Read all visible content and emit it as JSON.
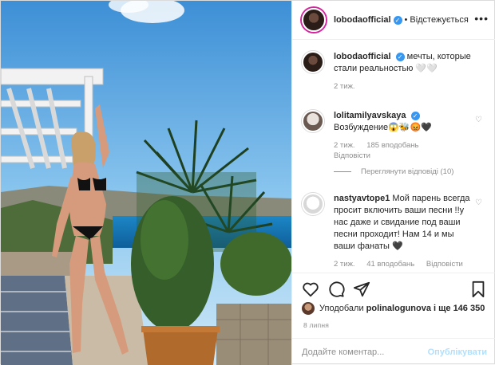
{
  "header": {
    "username": "lobodaofficial",
    "follow_state": "Відстежується",
    "separator": "•",
    "more": "•••"
  },
  "caption": {
    "username": "lobodaofficial",
    "text": "мечты, которые стали реальностью 🤍🤍",
    "time": "2 тиж."
  },
  "comments": [
    {
      "username": "lolitamilyavskaya",
      "text": "Возбуждение😱🐝😡🖤",
      "time": "2 тиж.",
      "likes": "185 вподобань",
      "reply": "Відповісти",
      "view_replies": "Переглянути відповіді (10)"
    },
    {
      "username": "nastyavtope1",
      "text": "Мой парень всегда просит включить ваши песни !!у нас даже и свидание под ваши песни проходит! Нам 14 и мы ваши фанаты 🖤",
      "time": "2 тиж.",
      "likes": "41 вподобань",
      "reply": "Відповісти"
    }
  ],
  "likes": {
    "prefix": "Уподобали",
    "user": "polinalogunova",
    "suffix": "і ще 146 350"
  },
  "date": "8 липня",
  "add_comment": {
    "placeholder": "Додайте коментар...",
    "publish": "Опублікувати"
  },
  "icons": {
    "heart": "heart-icon",
    "comment": "comment-icon",
    "share": "share-icon",
    "save": "bookmark-icon",
    "verified": "verified-badge-icon"
  },
  "colors": {
    "verified": "#3897f0",
    "muted": "#8e8e8e",
    "publish": "#b2dffc",
    "border": "#efefef"
  }
}
